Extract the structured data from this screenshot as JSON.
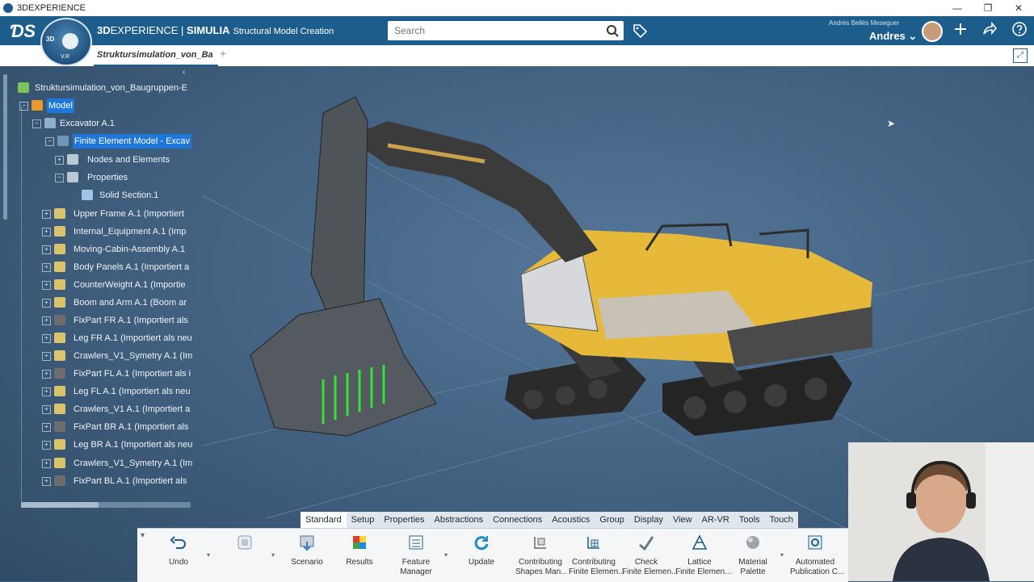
{
  "window": {
    "title": "3DEXPERIENCE",
    "min": "—",
    "restore": "❐",
    "close": "✕"
  },
  "appbar": {
    "compass_3d": "3D",
    "compass_vr": "V.R",
    "brand_prefix": "3D",
    "brand_mid": "EXPERIENCE | ",
    "brand_app": "SIMULIA",
    "brand_sub": "Structural Model Creation",
    "search_placeholder": "Search",
    "user_full": "Andrés Bellés Meseguer",
    "user_short": "Andres ⌄",
    "icons": [
      "tag-icon",
      "add-icon",
      "share-icon",
      "help-icon"
    ]
  },
  "tabs": [
    {
      "label": "Struktursimulation_von_Ba"
    }
  ],
  "tree": {
    "root": "Struktursimulation_von_Baugruppen-E",
    "items": [
      {
        "label": "Model",
        "selected": true
      },
      {
        "label": "Excavator A.1"
      },
      {
        "label": "Finite Element Model - Excav",
        "selected": true
      },
      {
        "label": "Nodes and Elements"
      },
      {
        "label": "Properties"
      },
      {
        "label": "Solid Section.1"
      },
      {
        "label": "Upper Frame A.1 (Importiert"
      },
      {
        "label": "Internal_Equipment A.1 (Imp"
      },
      {
        "label": "Moving-Cabin-Assembly A.1"
      },
      {
        "label": "Body Panels A.1 (Importiert a"
      },
      {
        "label": "CounterWeight A.1 (Importie"
      },
      {
        "label": "Boom and Arm A.1 (Boom ar"
      },
      {
        "label": "FixPart FR A.1 (Importiert als"
      },
      {
        "label": "Leg FR A.1 (Importiert als neu"
      },
      {
        "label": "Crawlers_V1_Symetry A.1 (Im"
      },
      {
        "label": "FixPart FL A.1 (Importiert als i"
      },
      {
        "label": "Leg FL A.1 (Importiert als neu"
      },
      {
        "label": "Crawlers_V1 A.1 (Importiert a"
      },
      {
        "label": "FixPart BR A.1 (Importiert als"
      },
      {
        "label": "Leg BR A.1 (Importiert als neu"
      },
      {
        "label": "Crawlers_V1_Symetry A.1 (Im"
      },
      {
        "label": "FixPart BL A.1 (Importiert als"
      }
    ]
  },
  "command_tabs": [
    "Standard",
    "Setup",
    "Properties",
    "Abstractions",
    "Connections",
    "Acoustics",
    "Group",
    "Display",
    "View",
    "AR-VR",
    "Tools",
    "Touch"
  ],
  "toolbar": {
    "undo": "Undo",
    "scenario": "Scenario",
    "results": "Results",
    "feature_manager_1": "Feature",
    "feature_manager_2": "Manager",
    "update": "Update",
    "contrib_shapes_1": "Contributing",
    "contrib_shapes_2": "Shapes Man...",
    "contrib_fe_1": "Contributing",
    "contrib_fe_2": "Finite Elemen...",
    "check_1": "Check",
    "check_2": "Finite Elemen...",
    "lattice_1": "Lattice",
    "lattice_2": "Finite Elemen...",
    "material_1": "Material",
    "material_2": "Palette",
    "automated_1": "Automated",
    "automated_2": "Publication C..."
  },
  "colors": {
    "accent": "#1d5d8b",
    "selection": "#1f77d8",
    "viewport": "#3e5d7a"
  }
}
